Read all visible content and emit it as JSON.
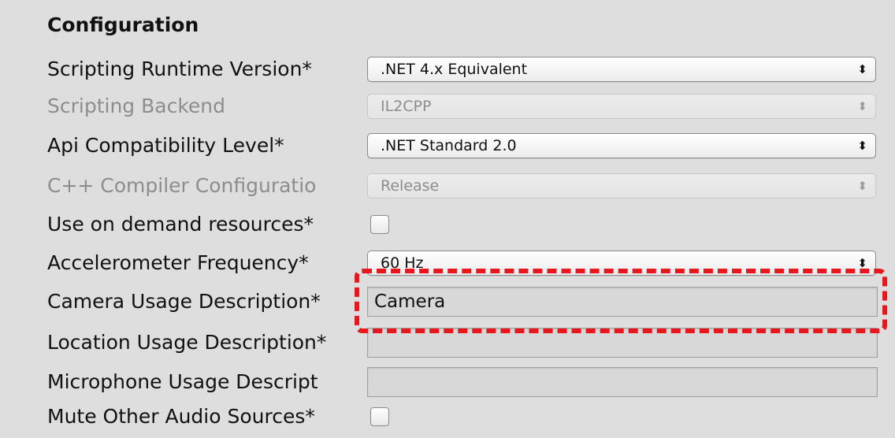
{
  "section": {
    "title": "Configuration"
  },
  "rows": {
    "scripting_runtime": {
      "label": "Scripting Runtime Version*",
      "value": ".NET 4.x Equivalent",
      "arrows": "⬍"
    },
    "scripting_backend": {
      "label": "Scripting Backend",
      "value": "IL2CPP",
      "arrows": "⬍"
    },
    "api_compat": {
      "label": "Api Compatibility Level*",
      "value": ".NET Standard 2.0",
      "arrows": "⬍"
    },
    "cpp_compiler": {
      "label": "C++ Compiler Configuratio",
      "value": "Release",
      "arrows": "⬍"
    },
    "on_demand": {
      "label": "Use on demand resources*"
    },
    "accelerometer": {
      "label": "Accelerometer Frequency*",
      "value": "60 Hz",
      "arrows": "⬍"
    },
    "camera_usage": {
      "label": "Camera Usage Description*",
      "value": "Camera"
    },
    "location_usage": {
      "label": "Location Usage Description*",
      "value": ""
    },
    "microphone_usage": {
      "label": "Microphone Usage Descript",
      "value": ""
    },
    "mute_audio": {
      "label": "Mute Other Audio Sources*"
    }
  },
  "colors": {
    "highlight": "#e8161d",
    "background": "#dedede",
    "disabled_text": "#8d8d8d"
  },
  "icons": {
    "dropdown_arrows": "up-down-arrows-icon",
    "checkbox": "checkbox-icon"
  }
}
